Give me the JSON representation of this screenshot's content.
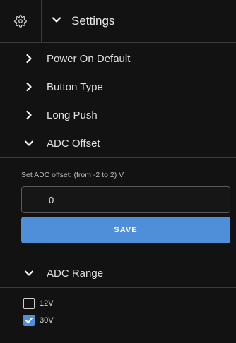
{
  "header": {
    "gear_icon": "gear-icon",
    "title": "Settings"
  },
  "sections": [
    {
      "label": "Power On Default",
      "state": "collapsed"
    },
    {
      "label": "Button Type",
      "state": "collapsed"
    },
    {
      "label": "Long Push",
      "state": "collapsed"
    },
    {
      "label": "ADC Offset",
      "state": "expanded"
    },
    {
      "label": "ADC Range",
      "state": "expanded"
    }
  ],
  "adc_offset": {
    "help": "Set ADC offset: (from -2 to 2) V.",
    "value": "0",
    "save_label": "SAVE"
  },
  "adc_range": {
    "options": [
      {
        "label": "12V",
        "checked": false
      },
      {
        "label": "30V",
        "checked": true
      }
    ]
  },
  "colors": {
    "background": "#121212",
    "accent": "#4f8fda",
    "divider": "#3a3a3a"
  }
}
